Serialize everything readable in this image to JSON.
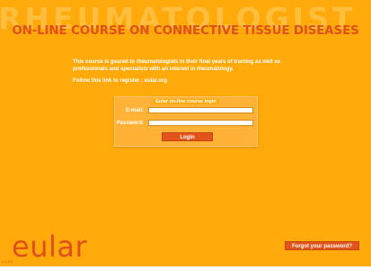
{
  "header": {
    "watermark": "RHEUMATOLOGIST",
    "title": "ON-LINE COURSE ON CONNECTIVE TISSUE DISEASES"
  },
  "intro": {
    "text": "This course is geared to rheumatologists in their final years of training as well as professionals and specialists with an interest in rheumatology.",
    "register": "Follow this link to register : eular.org"
  },
  "login": {
    "legend": "Eular on-line course login",
    "email_label": "E-mail:",
    "email_value": "",
    "password_label": "Password:",
    "password_value": "",
    "button_label": "Login"
  },
  "footer": {
    "logo_text": "eular",
    "version": "v 1.4.2",
    "forgot_label": "Forgot your password?"
  },
  "colors": {
    "background": "#ffaa0a",
    "accent": "#e05018",
    "text": "#ffffff"
  }
}
